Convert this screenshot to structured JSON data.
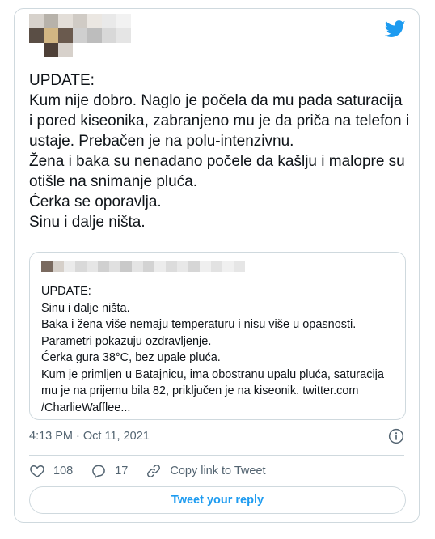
{
  "tweet": {
    "text": "UPDATE:\nKum nije dobro. Naglo je počela da mu pada saturacija i pored kiseonika, zabranjeno mu je da priča na telefon i ustaje. Prebačen je na polu-intenzivnu.\nŽena i baka su nenadano počele da kašlju i malopre su otišle na snimanje pluća.\nĆerka se oporavlja.\nSinu i dalje ništa.",
    "timestamp": "4:13 PM · Oct 11, 2021"
  },
  "quoted_tweet": {
    "text": "UPDATE:\nSinu i dalje ništa.\nBaka i žena više nemaju temperaturu i nisu više u opasnosti.\nParametri pokazuju ozdravljenje.\nĆerka gura 38°C, bez upale pluća.\nKum je primljen u Batajnicu, ima obostranu upalu pluća, saturacija mu je na prijemu bila 82, priključen je na kiseonik. twitter.com\n/CharlieWafflee..."
  },
  "actions": {
    "likes": "108",
    "replies": "17",
    "copy_link_label": "Copy link to Tweet",
    "reply_button_label": "Tweet your reply"
  },
  "icons": {
    "brand": "twitter-bird-icon",
    "info": "info-icon",
    "like": "heart-icon",
    "reply": "speech-bubble-icon",
    "link": "link-icon"
  },
  "colors": {
    "brand": "#1d9bf0",
    "text_primary": "#0f1419",
    "text_secondary": "#536471",
    "border": "#cfd9de"
  }
}
